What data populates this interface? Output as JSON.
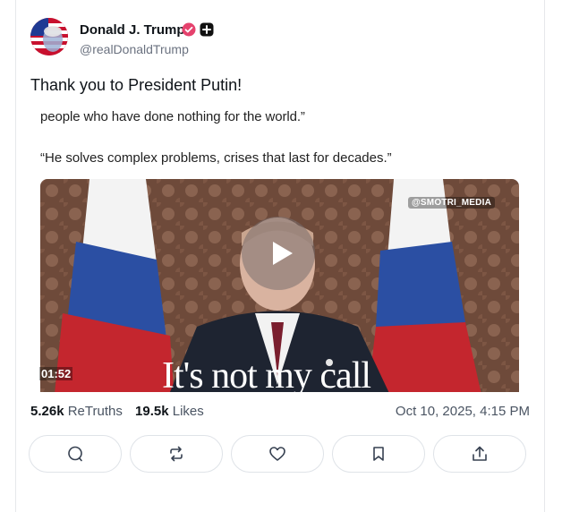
{
  "post": {
    "author_name": "Donald J. Trump",
    "author_handle": "@realDonaldTrump",
    "text": "Thank you to President Putin!",
    "timestamp": "Oct 10, 2025, 4:15 PM"
  },
  "media": {
    "quote_line_1": "people who have done nothing for the world.”",
    "quote_line_2": "“He solves complex problems, crises that last for decades.”",
    "watermark": "@SMOTRI_MEDIA",
    "duration": "01:52",
    "caption": "It's not my call"
  },
  "stats": {
    "retruths_count": "5.26k",
    "retruths_label": "ReTruths",
    "likes_count": "19.5k",
    "likes_label": "Likes"
  },
  "actions": [
    {
      "icon": "reply-icon"
    },
    {
      "icon": "retruth-icon"
    },
    {
      "icon": "heart-icon"
    },
    {
      "icon": "bookmark-icon"
    },
    {
      "icon": "share-icon"
    }
  ],
  "colors": {
    "verified_badge": "#e5426d",
    "text_primary": "#0f1419",
    "text_secondary": "#4b5563",
    "border": "#dfe3e8"
  }
}
